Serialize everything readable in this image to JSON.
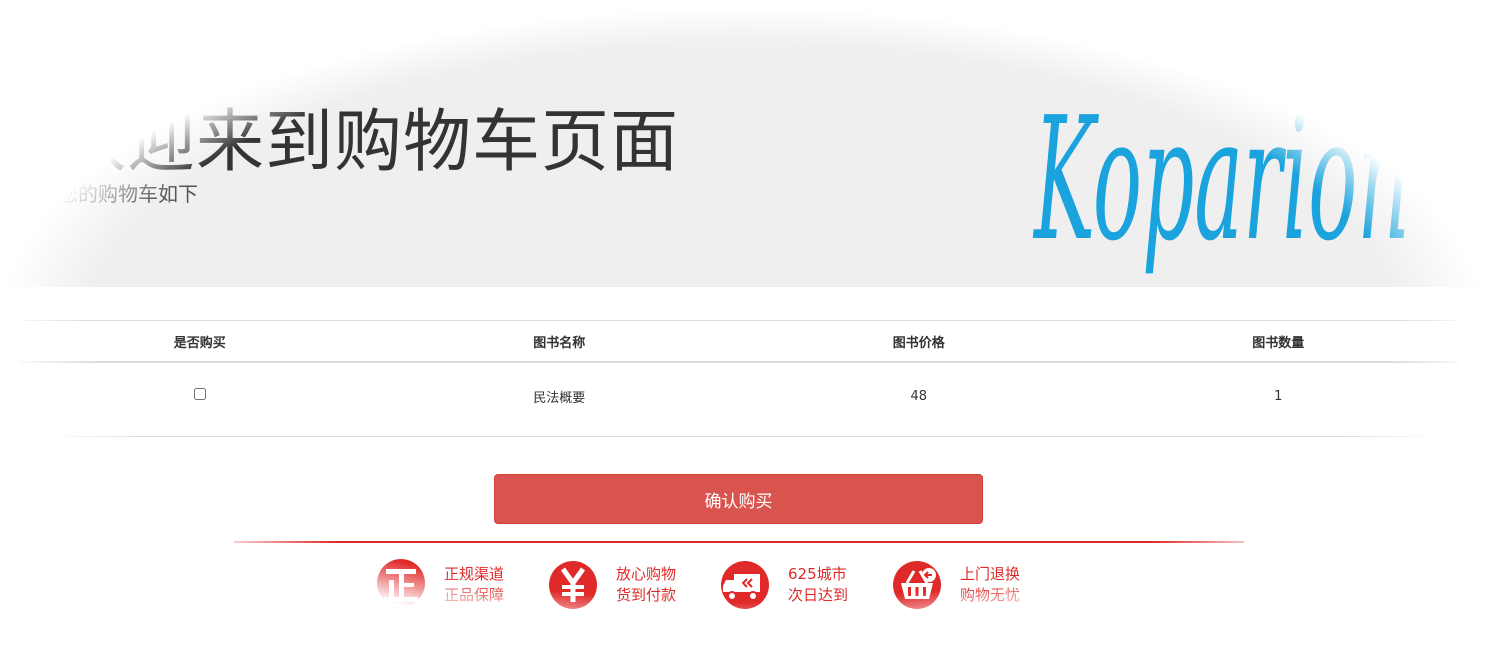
{
  "header": {
    "title": "欢迎来到购物车页面",
    "subtitle": "您的购物车如下",
    "logo_text": "Koparion"
  },
  "cart_table": {
    "columns": [
      "是否购买",
      "图书名称",
      "图书价格",
      "图书数量"
    ],
    "rows": [
      {
        "selected": false,
        "name": "民法概要",
        "price": "48",
        "quantity": "1"
      }
    ]
  },
  "actions": {
    "confirm_label": "确认购买"
  },
  "features": [
    {
      "icon": "zheng-badge-icon",
      "line1": "正规渠道",
      "line2": "正品保障"
    },
    {
      "icon": "yuan-badge-icon",
      "line1": "放心购物",
      "line2": "货到付款"
    },
    {
      "icon": "delivery-truck-icon",
      "line1": "625城市",
      "line2": "次日达到"
    },
    {
      "icon": "return-basket-icon",
      "line1": "上门退换",
      "line2": "购物无忧"
    }
  ],
  "colors": {
    "hero_bg": "#efefef",
    "confirm_button": "#d9534f",
    "feature_red": "#e02a2a",
    "logo_blue": "#1aa3dc"
  }
}
